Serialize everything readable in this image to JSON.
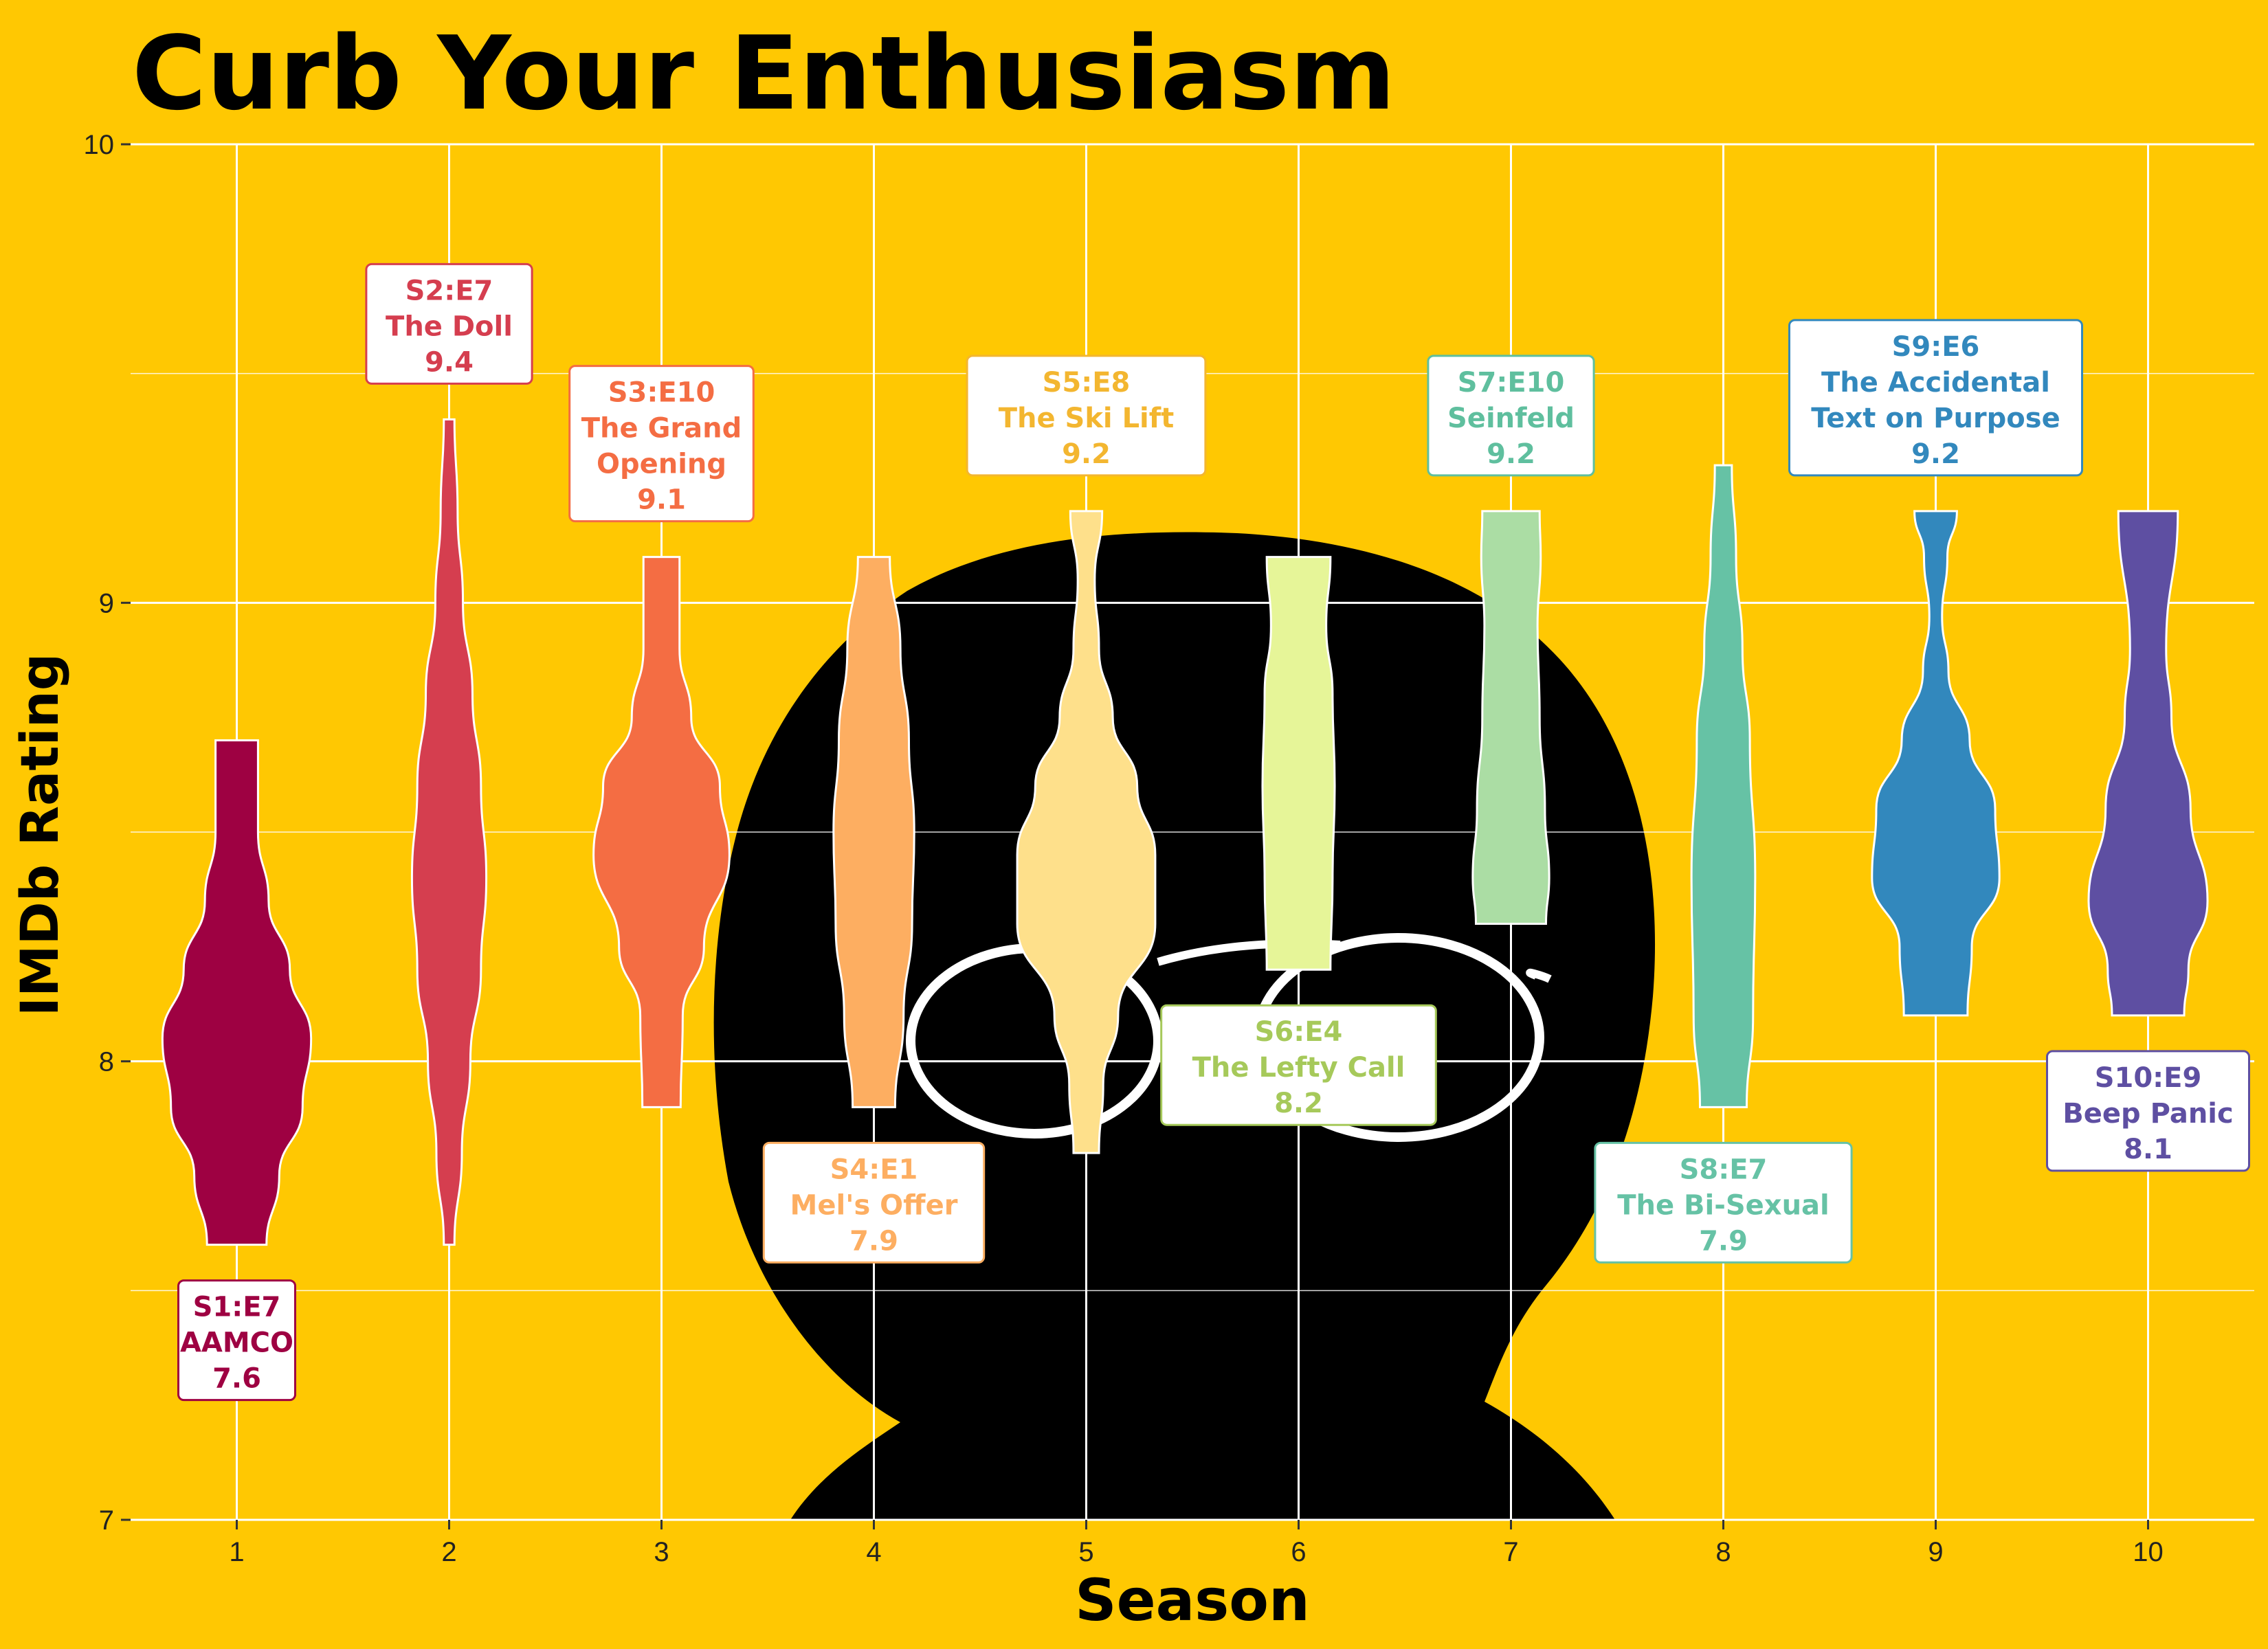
{
  "chart_data": {
    "type": "violin",
    "title": "Curb Your Enthusiasm",
    "xlabel": "Season",
    "ylabel": "IMDb Rating",
    "ylim": [
      7,
      10
    ],
    "yticks": [
      "7",
      "8",
      "9",
      "10"
    ],
    "grid": true,
    "colors": {
      "background": "#FFC802",
      "grid": "#FFFFFF",
      "silhouette": "#000000"
    },
    "series": [
      {
        "season": "1",
        "color": "#9E0142",
        "min": 7.6,
        "max": 8.7,
        "profile": [
          [
            7.6,
            0.28
          ],
          [
            7.75,
            0.4
          ],
          [
            7.9,
            0.62
          ],
          [
            8.05,
            0.7
          ],
          [
            8.2,
            0.5
          ],
          [
            8.35,
            0.3
          ],
          [
            8.5,
            0.2
          ],
          [
            8.7,
            0.2
          ]
        ],
        "best": {
          "code": "S1:E7",
          "name": "AAMCO",
          "rating": "7.6",
          "label_pos": "below"
        }
      },
      {
        "season": "2",
        "color": "#D53E4F",
        "min": 7.6,
        "max": 9.4,
        "profile": [
          [
            7.6,
            0.05
          ],
          [
            7.8,
            0.12
          ],
          [
            8.0,
            0.2
          ],
          [
            8.2,
            0.3
          ],
          [
            8.4,
            0.35
          ],
          [
            8.6,
            0.3
          ],
          [
            8.8,
            0.22
          ],
          [
            9.0,
            0.13
          ],
          [
            9.2,
            0.08
          ],
          [
            9.4,
            0.05
          ]
        ],
        "best": {
          "code": "S2:E7",
          "name": "The Doll",
          "rating": "9.4",
          "label_pos": "above"
        }
      },
      {
        "season": "3",
        "color": "#F46D43",
        "min": 7.9,
        "max": 9.1,
        "profile": [
          [
            7.9,
            0.18
          ],
          [
            8.1,
            0.2
          ],
          [
            8.25,
            0.4
          ],
          [
            8.45,
            0.64
          ],
          [
            8.6,
            0.55
          ],
          [
            8.75,
            0.28
          ],
          [
            8.9,
            0.17
          ],
          [
            9.1,
            0.17
          ]
        ],
        "best": {
          "code": "S3:E10",
          "name": "The Grand Opening",
          "rating": "9.1",
          "label_pos": "above"
        }
      },
      {
        "season": "4",
        "color": "#FDAE61",
        "min": 7.9,
        "max": 9.1,
        "profile": [
          [
            7.9,
            0.2
          ],
          [
            8.1,
            0.28
          ],
          [
            8.3,
            0.36
          ],
          [
            8.5,
            0.38
          ],
          [
            8.7,
            0.33
          ],
          [
            8.9,
            0.25
          ],
          [
            9.1,
            0.15
          ]
        ],
        "best": {
          "code": "S4:E1",
          "name": "Mel's Offer",
          "rating": "7.9",
          "label_pos": "below"
        }
      },
      {
        "season": "5",
        "color": "#FEE08B",
        "min": 7.8,
        "max": 9.2,
        "profile": [
          [
            7.8,
            0.12
          ],
          [
            7.95,
            0.16
          ],
          [
            8.1,
            0.3
          ],
          [
            8.3,
            0.65
          ],
          [
            8.45,
            0.65
          ],
          [
            8.6,
            0.48
          ],
          [
            8.75,
            0.25
          ],
          [
            8.9,
            0.12
          ],
          [
            9.05,
            0.08
          ],
          [
            9.2,
            0.15
          ]
        ],
        "best": {
          "code": "S5:E8",
          "name": "The Ski Lift",
          "rating": "9.2",
          "label_pos": "above"
        }
      },
      {
        "season": "6",
        "color": "#E6F598",
        "min": 8.2,
        "max": 9.1,
        "profile": [
          [
            8.2,
            0.3
          ],
          [
            8.4,
            0.32
          ],
          [
            8.6,
            0.34
          ],
          [
            8.8,
            0.32
          ],
          [
            8.95,
            0.26
          ],
          [
            9.1,
            0.3
          ]
        ],
        "best": {
          "code": "S6:E4",
          "name": "The Lefty Call",
          "rating": "8.2",
          "label_pos": "below"
        }
      },
      {
        "season": "7",
        "color": "#ABDDA4",
        "min": 8.3,
        "max": 9.2,
        "profile": [
          [
            8.3,
            0.33
          ],
          [
            8.4,
            0.36
          ],
          [
            8.55,
            0.32
          ],
          [
            8.75,
            0.27
          ],
          [
            8.95,
            0.25
          ],
          [
            9.1,
            0.28
          ],
          [
            9.2,
            0.27
          ]
        ],
        "best": {
          "code": "S7:E10",
          "name": "Seinfeld",
          "rating": "9.2",
          "label_pos": "above"
        }
      },
      {
        "season": "8",
        "color": "#66C2A5",
        "min": 7.9,
        "max": 9.3,
        "profile": [
          [
            7.9,
            0.22
          ],
          [
            8.1,
            0.28
          ],
          [
            8.4,
            0.3
          ],
          [
            8.7,
            0.25
          ],
          [
            8.9,
            0.18
          ],
          [
            9.1,
            0.12
          ],
          [
            9.3,
            0.08
          ]
        ],
        "best": {
          "code": "S8:E7",
          "name": "The Bi-Sexual",
          "rating": "7.9",
          "label_pos": "below"
        }
      },
      {
        "season": "9",
        "color": "#3288BD",
        "min": 8.1,
        "max": 9.2,
        "profile": [
          [
            8.1,
            0.3
          ],
          [
            8.25,
            0.34
          ],
          [
            8.4,
            0.6
          ],
          [
            8.55,
            0.56
          ],
          [
            8.7,
            0.32
          ],
          [
            8.85,
            0.12
          ],
          [
            8.97,
            0.06
          ],
          [
            9.1,
            0.11
          ],
          [
            9.2,
            0.2
          ]
        ],
        "best": {
          "code": "S9:E6",
          "name": "The Accidental Text on Purpose",
          "rating": "9.2",
          "label_pos": "above"
        }
      },
      {
        "season": "10",
        "color": "#5E4FA2",
        "min": 8.1,
        "max": 9.2,
        "profile": [
          [
            8.1,
            0.34
          ],
          [
            8.2,
            0.38
          ],
          [
            8.35,
            0.56
          ],
          [
            8.55,
            0.4
          ],
          [
            8.75,
            0.22
          ],
          [
            8.9,
            0.17
          ],
          [
            9.2,
            0.28
          ]
        ],
        "best": {
          "code": "S10:E9",
          "name": "Beep Panic",
          "rating": "8.1",
          "label_pos": "below"
        }
      }
    ]
  }
}
